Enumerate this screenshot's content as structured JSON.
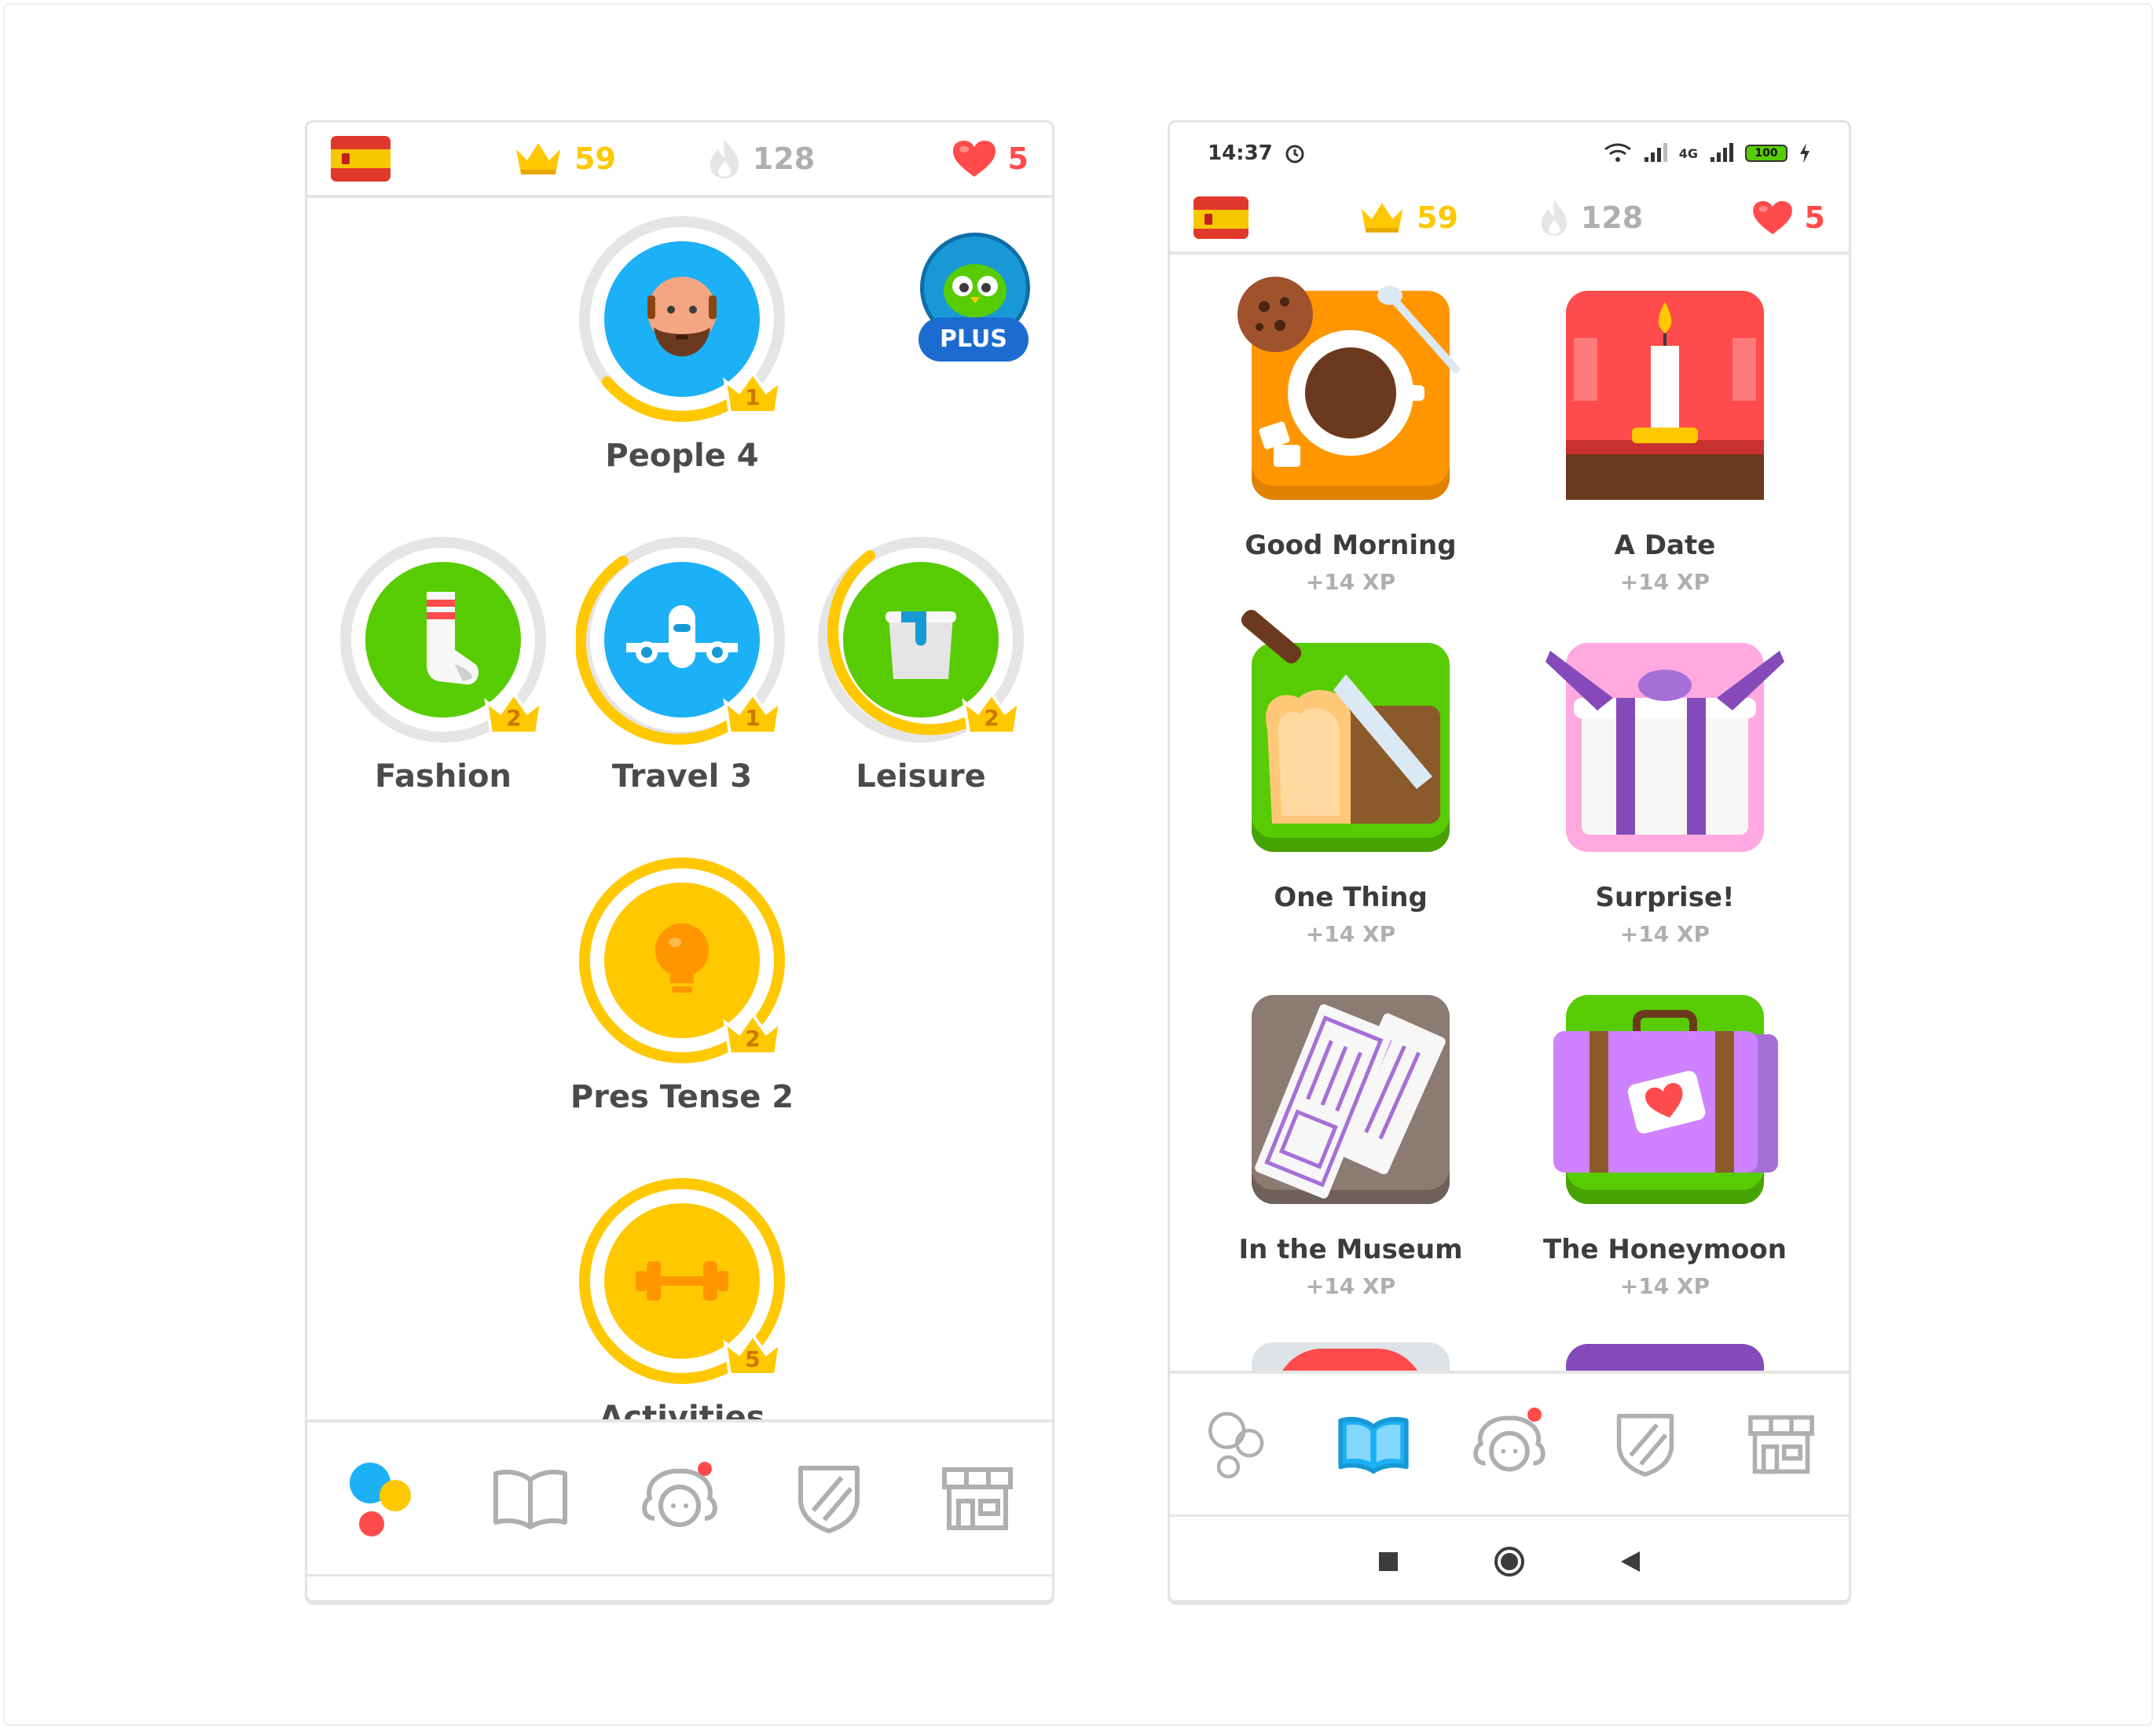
{
  "stats": {
    "crowns": "59",
    "streak": "128",
    "hearts": "5"
  },
  "left": {
    "skills": [
      {
        "label": "People 4",
        "level": "1"
      },
      {
        "label": "Fashion",
        "level": "2"
      },
      {
        "label": "Travel 3",
        "level": "1"
      },
      {
        "label": "Leisure",
        "level": "2"
      },
      {
        "label": "Pres Tense 2",
        "level": "2"
      },
      {
        "label": "Activities",
        "level": "5"
      }
    ],
    "plus_label": "PLUS"
  },
  "right": {
    "status": {
      "time": "14:37",
      "battery": "100",
      "network": "4G"
    },
    "stories": [
      {
        "title": "Good Morning",
        "xp": "+14 XP"
      },
      {
        "title": "A Date",
        "xp": "+14 XP"
      },
      {
        "title": "One Thing",
        "xp": "+14 XP"
      },
      {
        "title": "Surprise!",
        "xp": "+14 XP"
      },
      {
        "title": "In the Museum",
        "xp": "+14 XP"
      },
      {
        "title": "The Honeymoon",
        "xp": "+14 XP"
      }
    ]
  },
  "colors": {
    "gold": "#ffc800",
    "blue": "#1cb0f6",
    "green": "#58cc02",
    "red": "#ff4b4b",
    "gray": "#e5e5e5"
  },
  "icons": {
    "nav": [
      "learn-icon",
      "stories-icon",
      "profile-icon",
      "leagues-icon",
      "shop-icon"
    ],
    "system": [
      "recents-icon",
      "home-icon",
      "back-icon"
    ]
  }
}
